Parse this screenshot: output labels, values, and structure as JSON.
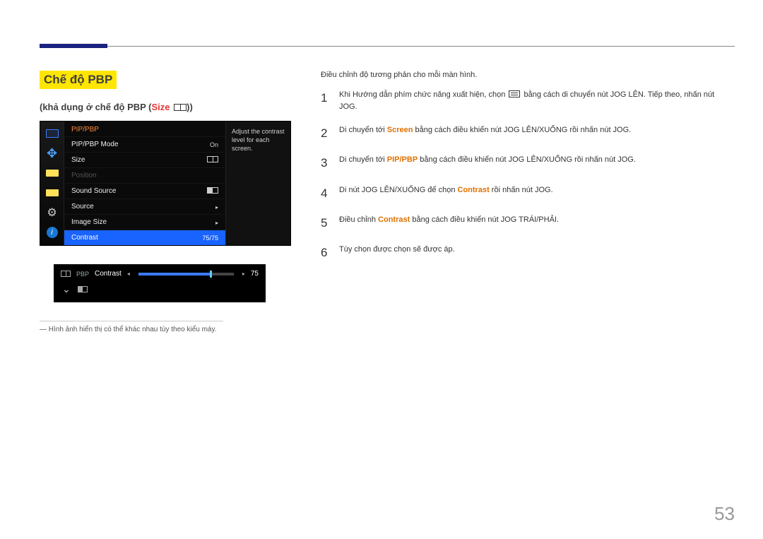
{
  "page_number": "53",
  "section_title": "Chế độ PBP",
  "subtitle_prefix": "(khả dụng ở chế độ PBP (",
  "subtitle_size_word": "Size",
  "subtitle_suffix": "))",
  "osd": {
    "header": "PIP/PBP",
    "tip": "Adjust the contrast level for each screen.",
    "rows": {
      "mode_label": "PIP/PBP Mode",
      "mode_value": "On",
      "size_label": "Size",
      "position_label": "Position",
      "sound_label": "Sound Source",
      "source_label": "Source",
      "imgsize_label": "Image Size",
      "contrast_label": "Contrast",
      "contrast_value": "75/75"
    }
  },
  "slider": {
    "pbp_tag": "PBP",
    "label": "Contrast",
    "value": "75"
  },
  "footnote": "― Hình ảnh hiển thị có thể khác nhau tùy theo kiểu máy.",
  "intro": "Điều chỉnh độ tương phản cho mỗi màn hình.",
  "steps": {
    "s1a": "Khi Hướng dẫn phím chức năng xuất hiện, chọn ",
    "s1b": " bằng cách di chuyển nút JOG LÊN. Tiếp theo, nhấn nút JOG.",
    "s2a": "Di chuyển tới ",
    "s2_screen": "Screen",
    "s2b": " bằng cách điều khiển nút JOG LÊN/XUỐNG rồi nhấn nút JOG.",
    "s3a": "Di chuyển tới ",
    "s3_pip": "PIP/PBP",
    "s3b": " bằng cách điều khiển nút JOG LÊN/XUỐNG rồi nhấn nút JOG.",
    "s4a": "Di nút JOG LÊN/XUỐNG để chọn ",
    "s4_contrast": "Contrast",
    "s4b": " rồi nhấn nút JOG.",
    "s5a": "Điều chỉnh ",
    "s5_contrast": "Contrast",
    "s5b": " bằng cách điều khiển nút JOG TRÁI/PHẢI.",
    "s6": "Tùy chọn được chọn sẽ được áp."
  }
}
